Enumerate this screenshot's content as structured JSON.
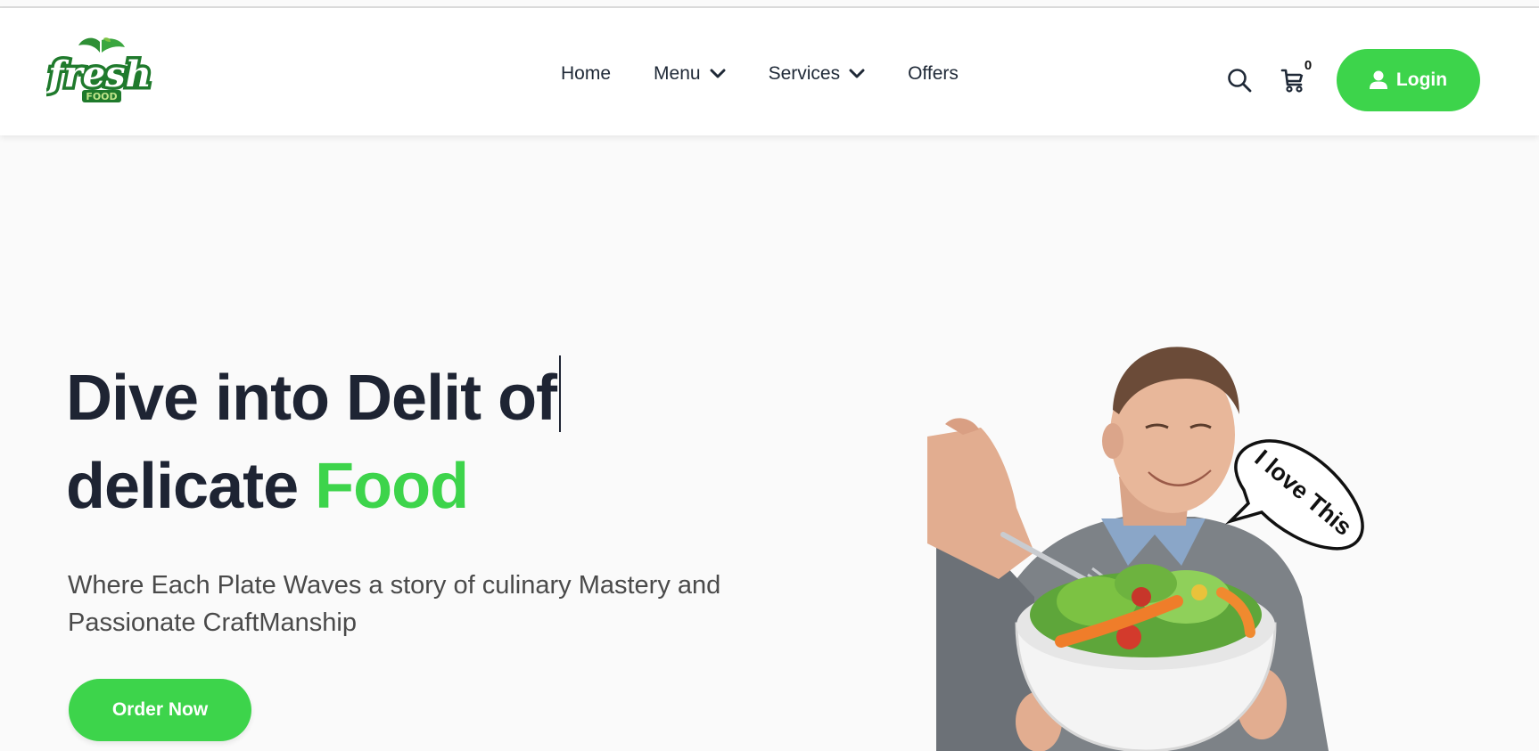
{
  "brand": {
    "logo_word": "fresh",
    "logo_sub": "FOOD",
    "colors": {
      "accent": "#3dd44b",
      "logo_dark": "#1f7a2c",
      "heading": "#1e2433"
    }
  },
  "nav": {
    "items": [
      {
        "label": "Home",
        "has_dropdown": false
      },
      {
        "label": "Menu",
        "has_dropdown": true
      },
      {
        "label": "Services",
        "has_dropdown": true
      },
      {
        "label": "Offers",
        "has_dropdown": false
      }
    ]
  },
  "header_actions": {
    "search_icon": "search-icon",
    "cart_icon": "cart-icon",
    "cart_count": "0",
    "login_label": "Login",
    "login_icon": "user-icon"
  },
  "hero": {
    "title_line1": "Dive into Delit of",
    "title_line2_plain": "delicate ",
    "title_line2_accent": "Food",
    "subtitle": "Where Each Plate Waves a story of culinary Mastery and Passionate CraftManship",
    "cta_label": "Order Now",
    "bubble_text": "I love This"
  }
}
